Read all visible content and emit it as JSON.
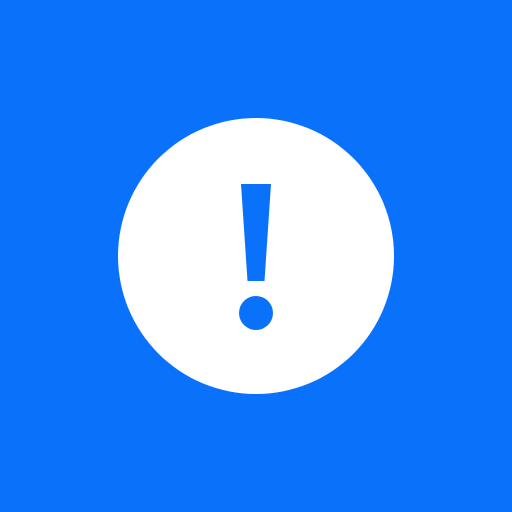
{
  "icon": {
    "name": "exclamation-icon",
    "background_color": "#0a72fa",
    "circle_color": "#ffffff",
    "glyph_color": "#0a72fa"
  }
}
